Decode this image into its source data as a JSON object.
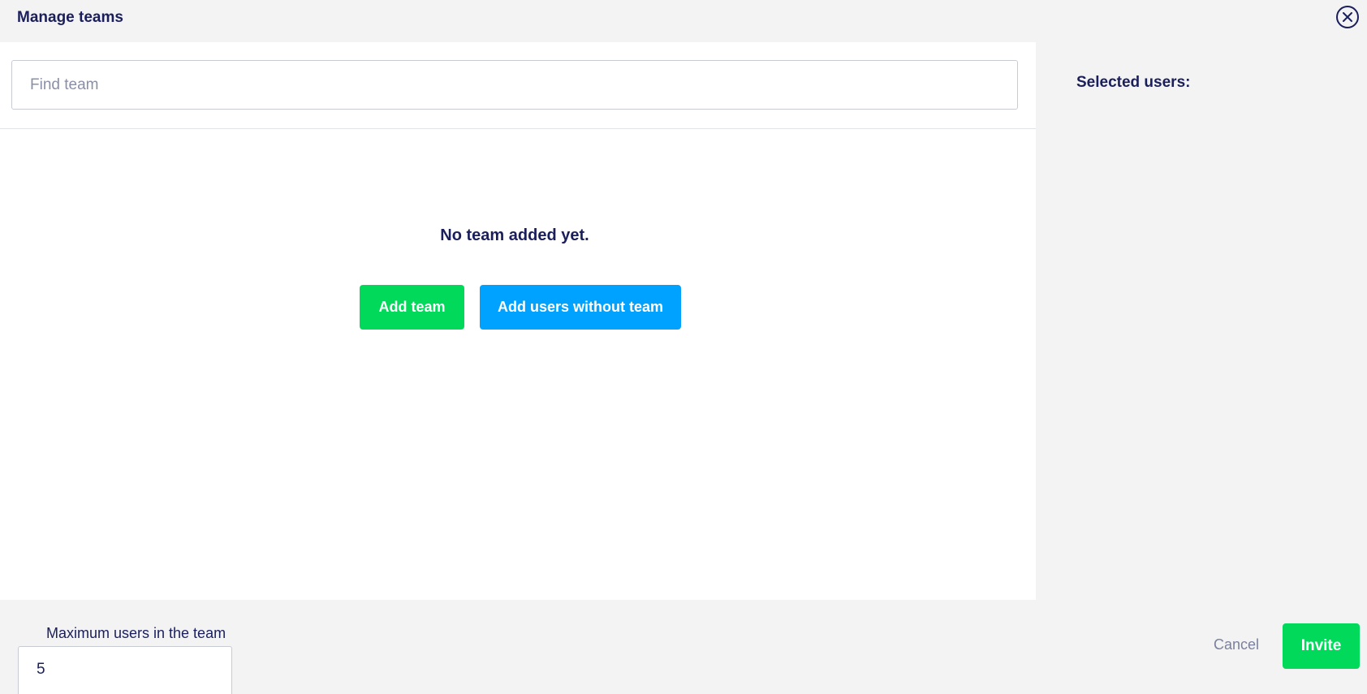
{
  "header": {
    "title": "Manage teams",
    "close_icon": "close-circle-icon"
  },
  "search": {
    "placeholder": "Find team",
    "value": ""
  },
  "empty_state": {
    "message": "No team added yet.",
    "add_team_label": "Add team",
    "add_users_label": "Add users without team"
  },
  "sidebar": {
    "selected_users_label": "Selected users:"
  },
  "footer": {
    "max_users_label": "Maximum users in the team",
    "max_users_value": "5",
    "cancel_label": "Cancel",
    "invite_label": "Invite"
  },
  "colors": {
    "primary_text": "#1a1f5c",
    "green": "#00d95a",
    "blue": "#00a2ff",
    "panel_bg": "#f3f3f4"
  }
}
